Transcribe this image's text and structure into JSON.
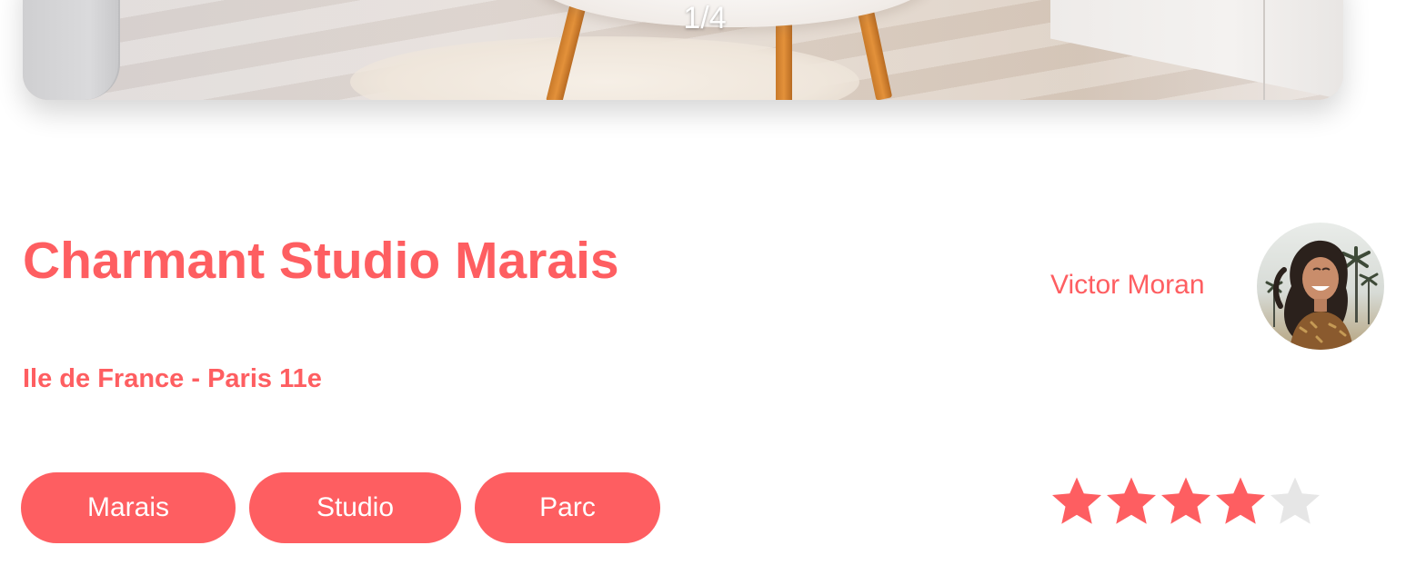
{
  "carousel": {
    "counter": "1/4"
  },
  "listing": {
    "title": "Charmant Studio Marais",
    "location": "Ile de France - Paris 11e",
    "tags": [
      "Marais",
      "Studio",
      "Parc"
    ]
  },
  "host": {
    "name": "Victor Moran"
  },
  "rating": {
    "value": 4,
    "max": 5
  },
  "colors": {
    "accent": "#fe5e61",
    "star_filled": "#fe5e61",
    "star_empty": "#e6e6e6"
  }
}
